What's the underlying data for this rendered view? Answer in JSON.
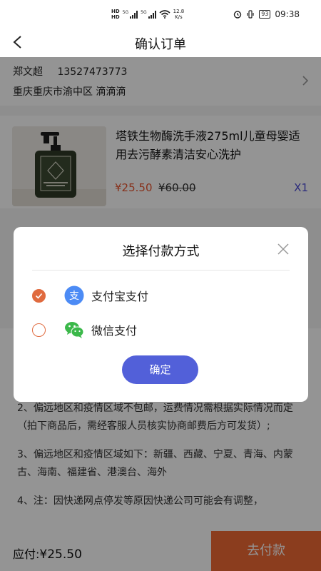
{
  "status_bar": {
    "hd_top": "HD",
    "hd_bottom": "HD",
    "sig1": "5G",
    "sig2": "5G",
    "speed_value": "12.8",
    "speed_unit": "K/s",
    "battery": "93",
    "time": "09:38"
  },
  "nav": {
    "title": "确认订单"
  },
  "address": {
    "name": "郑文超",
    "phone": "13527473773",
    "detail": "重庆重庆市渝中区 滴滴滴"
  },
  "product": {
    "name": "塔铁生物酶洗手液275ml儿童母婴适用去污酵素清洁安心洗护",
    "price": "¥25.50",
    "original_price": "¥60.00",
    "quantity": "X1"
  },
  "notes": [
    "2、偏远地区和疫情区域不包邮，运费情况需根据实际情况而定（拍下商品后，需经客服人员核实协商邮费后方可发货）;",
    "3、偏远地区和疫情区域如下：新疆、西藏、宁夏、青海、内蒙古、海南、福建省、港澳台、海外",
    "4、注：因快递网点停发等原因快递公司可能会有调整，"
  ],
  "bottom": {
    "total_label": "应付:",
    "total_amount": "¥25.50",
    "pay_button": "去付款"
  },
  "modal": {
    "title": "选择付款方式",
    "options": [
      {
        "label": "支付宝支付",
        "icon": "alipay-icon",
        "selected": true
      },
      {
        "label": "微信支付",
        "icon": "wechat-icon",
        "selected": false
      }
    ],
    "confirm": "确定"
  },
  "colors": {
    "accent": "#ef6a35",
    "radio": "#e06b3f",
    "confirm": "#5260d9",
    "price": "#e8552f",
    "quantity": "#4b4bd6",
    "alipay": "#4c8bf5",
    "wechat": "#3bb84a"
  }
}
